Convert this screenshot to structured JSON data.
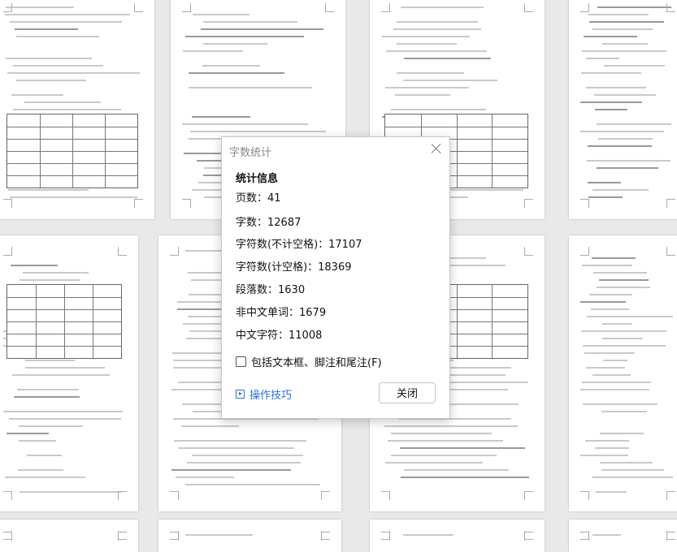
{
  "dialog": {
    "title": "字数统计",
    "heading": "统计信息",
    "stats": [
      "页数：41",
      "字数：12687",
      "字符数(不计空格)：17107",
      "字符数(计空格)：18369",
      "段落数：1630",
      "非中文单词：1679",
      "中文字符：11008"
    ],
    "include_label": "包括文本框、脚注和尾注(F)",
    "tips_label": "操作技巧",
    "close_label": "关闭"
  }
}
